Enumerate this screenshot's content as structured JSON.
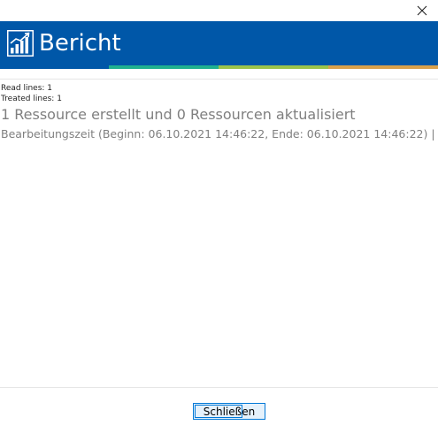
{
  "window": {
    "close_icon": "close-icon"
  },
  "banner": {
    "icon": "bar-chart-icon",
    "title": "Bericht",
    "background": "#0057a8",
    "stripe_colors": [
      "#0057a8",
      "#1fb08f",
      "#9bc34a",
      "#d9a14c"
    ]
  },
  "report": {
    "read_lines": "Read lines: 1",
    "treated_lines": "Treated lines: 1",
    "summary": "1 Ressource erstellt und 0 Ressourcen aktualisiert",
    "timing": "Bearbeitungszeit (Beginn: 06.10.2021 14:46:22, Ende: 06.10.2021 14:46:22) |"
  },
  "footer": {
    "close_label": "Schließen"
  }
}
